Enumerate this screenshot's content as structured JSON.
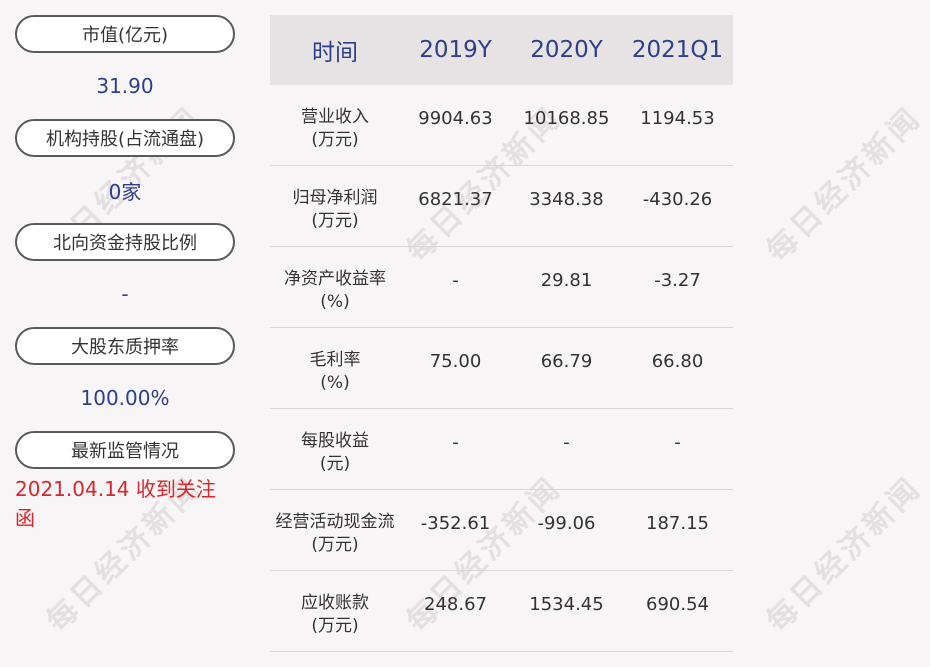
{
  "watermark_text": "每日经济新闻",
  "left_panel": {
    "items": [
      {
        "label": "市值(亿元)",
        "value": "31.90"
      },
      {
        "label": "机构持股(占流通盘)",
        "value": "0家"
      },
      {
        "label": "北向资金持股比例",
        "value": "-"
      },
      {
        "label": "大股东质押率",
        "value": "100.00%"
      },
      {
        "label": "最新监管情况",
        "value": "2021.04.14 收到关注函"
      }
    ]
  },
  "table": {
    "headers": [
      "时间",
      "2019Y",
      "2020Y",
      "2021Q1"
    ],
    "rows": [
      {
        "label1": "营业收入",
        "label2": "(万元)",
        "values": [
          "9904.63",
          "10168.85",
          "1194.53"
        ]
      },
      {
        "label1": "归母净利润",
        "label2": "(万元)",
        "values": [
          "6821.37",
          "3348.38",
          "-430.26"
        ]
      },
      {
        "label1": "净资产收益率",
        "label2": "(%)",
        "values": [
          "-",
          "29.81",
          "-3.27"
        ]
      },
      {
        "label1": "毛利率",
        "label2": "(%)",
        "values": [
          "75.00",
          "66.79",
          "66.80"
        ]
      },
      {
        "label1": "每股收益",
        "label2": "(元)",
        "values": [
          "-",
          "-",
          "-"
        ]
      },
      {
        "label1": "经营活动现金流",
        "label2": "(万元)",
        "values": [
          "-352.61",
          "-99.06",
          "187.15"
        ]
      },
      {
        "label1": "应收账款",
        "label2": "(万元)",
        "values": [
          "248.67",
          "1534.45",
          "690.54"
        ]
      }
    ]
  },
  "colors": {
    "value_blue": "#2b3f8a",
    "alert_red": "#d8262c",
    "header_bg": "#e7e3e5",
    "page_bg": "#f8f5f6"
  }
}
